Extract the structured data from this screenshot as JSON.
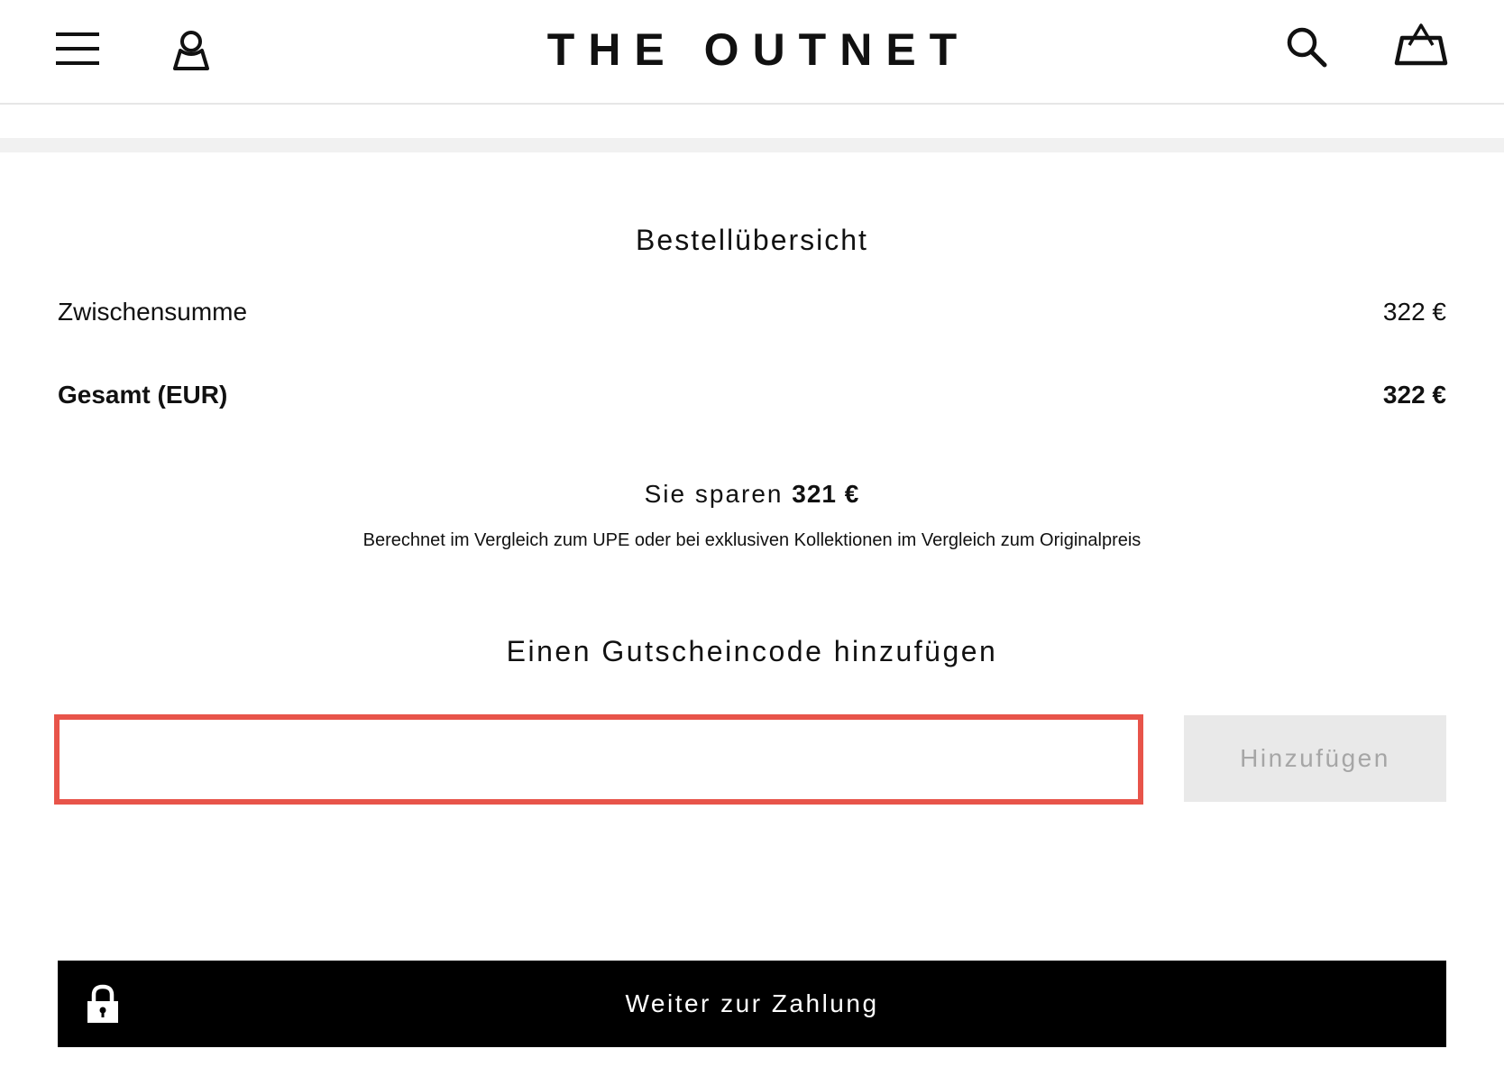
{
  "header": {
    "brand": "THE OUTNET",
    "icons": {
      "menu": "hamburger-menu-icon",
      "account": "user-icon",
      "search": "search-icon",
      "bag": "shopping-bag-icon"
    }
  },
  "summary": {
    "title": "Bestellübersicht",
    "subtotal_label": "Zwischensumme",
    "subtotal_value": "322 €",
    "total_label": "Gesamt (EUR)",
    "total_value": "322 €",
    "savings_prefix": "Sie sparen",
    "savings_amount": "321 €",
    "savings_note": "Berechnet im Vergleich zum UPE oder bei exklusiven Kollektionen im Vergleich zum Originalpreis"
  },
  "voucher": {
    "title": "Einen Gutscheincode hinzufügen",
    "input_value": "",
    "input_placeholder": "",
    "button_label": "Hinzufügen"
  },
  "checkout": {
    "button_label": "Weiter zur Zahlung",
    "icon": "lock-icon"
  },
  "colors": {
    "input_border_error": "#e8544a",
    "disabled_button_bg": "#e9e9e9",
    "disabled_button_text": "#a6a6a6",
    "primary_button_bg": "#000000"
  }
}
